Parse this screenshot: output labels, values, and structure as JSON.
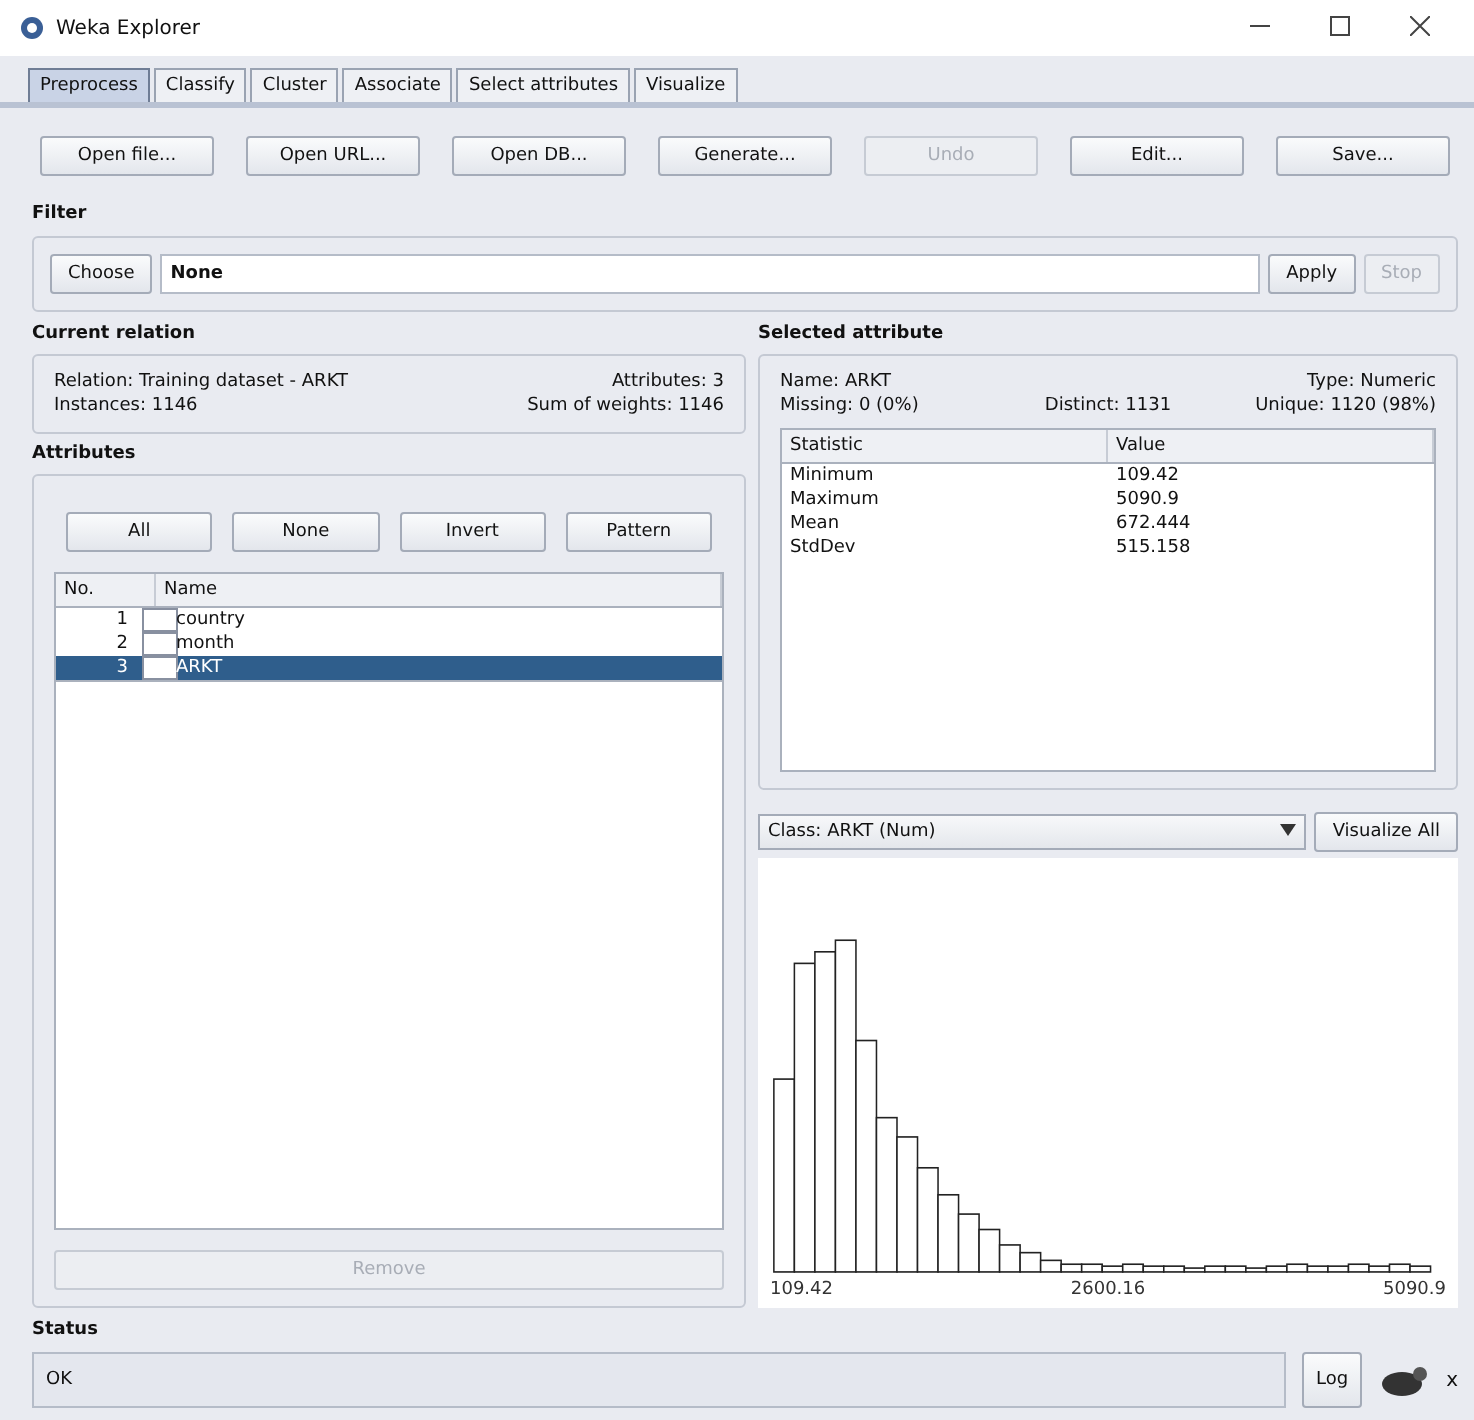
{
  "window": {
    "title": "Weka Explorer"
  },
  "tabs": [
    {
      "label": "Preprocess",
      "selected": true
    },
    {
      "label": "Classify",
      "selected": false
    },
    {
      "label": "Cluster",
      "selected": false
    },
    {
      "label": "Associate",
      "selected": false
    },
    {
      "label": "Select attributes",
      "selected": false
    },
    {
      "label": "Visualize",
      "selected": false
    }
  ],
  "toolbar": [
    {
      "label": "Open file...",
      "disabled": false
    },
    {
      "label": "Open URL...",
      "disabled": false
    },
    {
      "label": "Open DB...",
      "disabled": false
    },
    {
      "label": "Generate...",
      "disabled": false
    },
    {
      "label": "Undo",
      "disabled": true
    },
    {
      "label": "Edit...",
      "disabled": false
    },
    {
      "label": "Save...",
      "disabled": false
    }
  ],
  "filter": {
    "heading": "Filter",
    "choose": "Choose",
    "value": "None",
    "apply": {
      "label": "Apply",
      "disabled": false
    },
    "stop": {
      "label": "Stop",
      "disabled": true
    }
  },
  "current_relation": {
    "heading": "Current relation",
    "relation": "Relation: Training dataset - ARKT",
    "instances": "Instances: 1146",
    "attributes": "Attributes: 3",
    "sum_of_weights": "Sum of weights: 1146"
  },
  "attributes": {
    "heading": "Attributes",
    "buttons": [
      "All",
      "None",
      "Invert",
      "Pattern"
    ],
    "columns": [
      "No.",
      "Name"
    ],
    "rows": [
      {
        "no": "1",
        "name": "country",
        "checked": false,
        "selected": false
      },
      {
        "no": "2",
        "name": "month",
        "checked": false,
        "selected": false
      },
      {
        "no": "3",
        "name": "ARKT",
        "checked": false,
        "selected": true
      }
    ],
    "remove": {
      "label": "Remove",
      "disabled": true
    }
  },
  "selected_attribute": {
    "heading": "Selected attribute",
    "name": "Name: ARKT",
    "type": "Type: Numeric",
    "missing": "Missing: 0 (0%)",
    "distinct": "Distinct: 1131",
    "unique": "Unique: 1120 (98%)",
    "columns": [
      "Statistic",
      "Value"
    ],
    "rows": [
      [
        "Minimum",
        "109.42"
      ],
      [
        "Maximum",
        "5090.9"
      ],
      [
        "Mean",
        "672.444"
      ],
      [
        "StdDev",
        "515.158"
      ]
    ]
  },
  "class_select": {
    "value": "Class: ARKT (Num)"
  },
  "visualize_all": "Visualize All",
  "histogram": {
    "axis_labels": [
      "109.42",
      "2600.16",
      "5090.9"
    ]
  },
  "status": {
    "heading": "Status",
    "text": "OK"
  },
  "log_button": "Log",
  "task_count": "x"
}
